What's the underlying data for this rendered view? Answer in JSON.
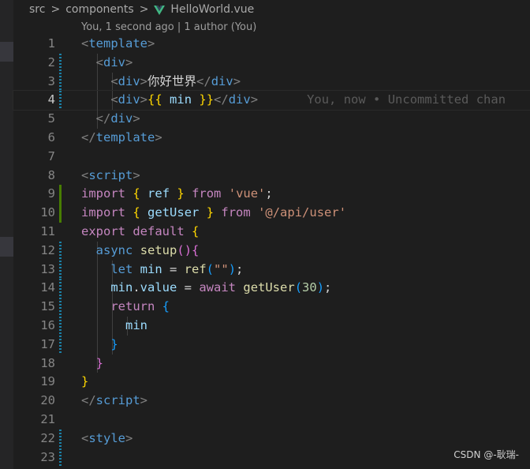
{
  "breadcrumb": {
    "items": [
      "src",
      "components"
    ],
    "file": "HelloWorld.vue"
  },
  "blame_header": "You, 1 second ago | 1 author (You)",
  "inline_blame": "You, now • Uncommitted chan",
  "current_line": 4,
  "lines": [
    {
      "n": "1",
      "tokens": [
        [
          "tag",
          "<"
        ],
        [
          "name",
          "template"
        ],
        [
          "tag",
          ">"
        ]
      ]
    },
    {
      "n": "2",
      "tokens": [
        [
          "text",
          "  "
        ],
        [
          "tag",
          "<"
        ],
        [
          "name",
          "div"
        ],
        [
          "tag",
          ">"
        ]
      ]
    },
    {
      "n": "3",
      "tokens": [
        [
          "text",
          "    "
        ],
        [
          "tag",
          "<"
        ],
        [
          "name",
          "div"
        ],
        [
          "tag",
          ">"
        ],
        [
          "text",
          "你好世界"
        ],
        [
          "tag",
          "</"
        ],
        [
          "name",
          "div"
        ],
        [
          "tag",
          ">"
        ]
      ]
    },
    {
      "n": "4",
      "tokens": [
        [
          "text",
          "    "
        ],
        [
          "tag",
          "<"
        ],
        [
          "name",
          "div"
        ],
        [
          "tag",
          ">"
        ],
        [
          "b1",
          "{{"
        ],
        [
          "text",
          " "
        ],
        [
          "var",
          "min"
        ],
        [
          "text",
          " "
        ],
        [
          "b1",
          "}}"
        ],
        [
          "tag",
          "</"
        ],
        [
          "name",
          "div"
        ],
        [
          "tag",
          ">"
        ]
      ]
    },
    {
      "n": "5",
      "tokens": [
        [
          "text",
          "  "
        ],
        [
          "tag",
          "</"
        ],
        [
          "name",
          "div"
        ],
        [
          "tag",
          ">"
        ]
      ]
    },
    {
      "n": "6",
      "tokens": [
        [
          "tag",
          "</"
        ],
        [
          "name",
          "template"
        ],
        [
          "tag",
          ">"
        ]
      ]
    },
    {
      "n": "7",
      "tokens": []
    },
    {
      "n": "8",
      "tokens": [
        [
          "tag",
          "<"
        ],
        [
          "name",
          "script"
        ],
        [
          "tag",
          ">"
        ]
      ]
    },
    {
      "n": "9",
      "tokens": [
        [
          "kw",
          "import"
        ],
        [
          "text",
          " "
        ],
        [
          "b1",
          "{"
        ],
        [
          "text",
          " "
        ],
        [
          "var",
          "ref"
        ],
        [
          "text",
          " "
        ],
        [
          "b1",
          "}"
        ],
        [
          "text",
          " "
        ],
        [
          "kw",
          "from"
        ],
        [
          "text",
          " "
        ],
        [
          "str",
          "'vue'"
        ],
        [
          "text",
          ";"
        ]
      ]
    },
    {
      "n": "10",
      "tokens": [
        [
          "kw",
          "import"
        ],
        [
          "text",
          " "
        ],
        [
          "b1",
          "{"
        ],
        [
          "text",
          " "
        ],
        [
          "var",
          "getUser"
        ],
        [
          "text",
          " "
        ],
        [
          "b1",
          "}"
        ],
        [
          "text",
          " "
        ],
        [
          "kw",
          "from"
        ],
        [
          "text",
          " "
        ],
        [
          "str",
          "'@/api/user'"
        ]
      ]
    },
    {
      "n": "11",
      "tokens": [
        [
          "kw",
          "export"
        ],
        [
          "text",
          " "
        ],
        [
          "kw",
          "default"
        ],
        [
          "text",
          " "
        ],
        [
          "b1",
          "{"
        ]
      ]
    },
    {
      "n": "12",
      "tokens": [
        [
          "text",
          "  "
        ],
        [
          "kw2",
          "async"
        ],
        [
          "text",
          " "
        ],
        [
          "fn",
          "setup"
        ],
        [
          "b2",
          "()"
        ],
        [
          "b2",
          "{"
        ]
      ]
    },
    {
      "n": "13",
      "tokens": [
        [
          "text",
          "    "
        ],
        [
          "kw2",
          "let"
        ],
        [
          "text",
          " "
        ],
        [
          "var",
          "min"
        ],
        [
          "text",
          " = "
        ],
        [
          "fn",
          "ref"
        ],
        [
          "b3",
          "("
        ],
        [
          "str",
          "\"\""
        ],
        [
          "b3",
          ")"
        ],
        [
          "text",
          ";"
        ]
      ]
    },
    {
      "n": "14",
      "tokens": [
        [
          "text",
          "    "
        ],
        [
          "var",
          "min"
        ],
        [
          "text",
          "."
        ],
        [
          "var",
          "value"
        ],
        [
          "text",
          " = "
        ],
        [
          "kw",
          "await"
        ],
        [
          "text",
          " "
        ],
        [
          "fn",
          "getUser"
        ],
        [
          "b3",
          "("
        ],
        [
          "num",
          "30"
        ],
        [
          "b3",
          ")"
        ],
        [
          "text",
          ";"
        ]
      ]
    },
    {
      "n": "15",
      "tokens": [
        [
          "text",
          "    "
        ],
        [
          "kw",
          "return"
        ],
        [
          "text",
          " "
        ],
        [
          "b3",
          "{"
        ]
      ]
    },
    {
      "n": "16",
      "tokens": [
        [
          "text",
          "      "
        ],
        [
          "var",
          "min"
        ]
      ]
    },
    {
      "n": "17",
      "tokens": [
        [
          "text",
          "    "
        ],
        [
          "b3",
          "}"
        ]
      ]
    },
    {
      "n": "18",
      "tokens": [
        [
          "text",
          "  "
        ],
        [
          "b2",
          "}"
        ]
      ]
    },
    {
      "n": "19",
      "tokens": [
        [
          "b1",
          "}"
        ]
      ]
    },
    {
      "n": "20",
      "tokens": [
        [
          "tag",
          "</"
        ],
        [
          "name",
          "script"
        ],
        [
          "tag",
          ">"
        ]
      ]
    },
    {
      "n": "21",
      "tokens": []
    },
    {
      "n": "22",
      "tokens": [
        [
          "tag",
          "<"
        ],
        [
          "name",
          "style"
        ],
        [
          "tag",
          ">"
        ]
      ]
    },
    {
      "n": "23",
      "tokens": []
    }
  ],
  "gutter": {
    "2": "modified",
    "3": "modified",
    "4": "modified",
    "9": "added",
    "10": "added",
    "12": "modified",
    "13": "modified",
    "14": "modified",
    "15": "modified",
    "16": "modified",
    "17": "modified",
    "22": "modified",
    "23": "modified"
  },
  "watermark": "CSDN @-耿瑞-"
}
